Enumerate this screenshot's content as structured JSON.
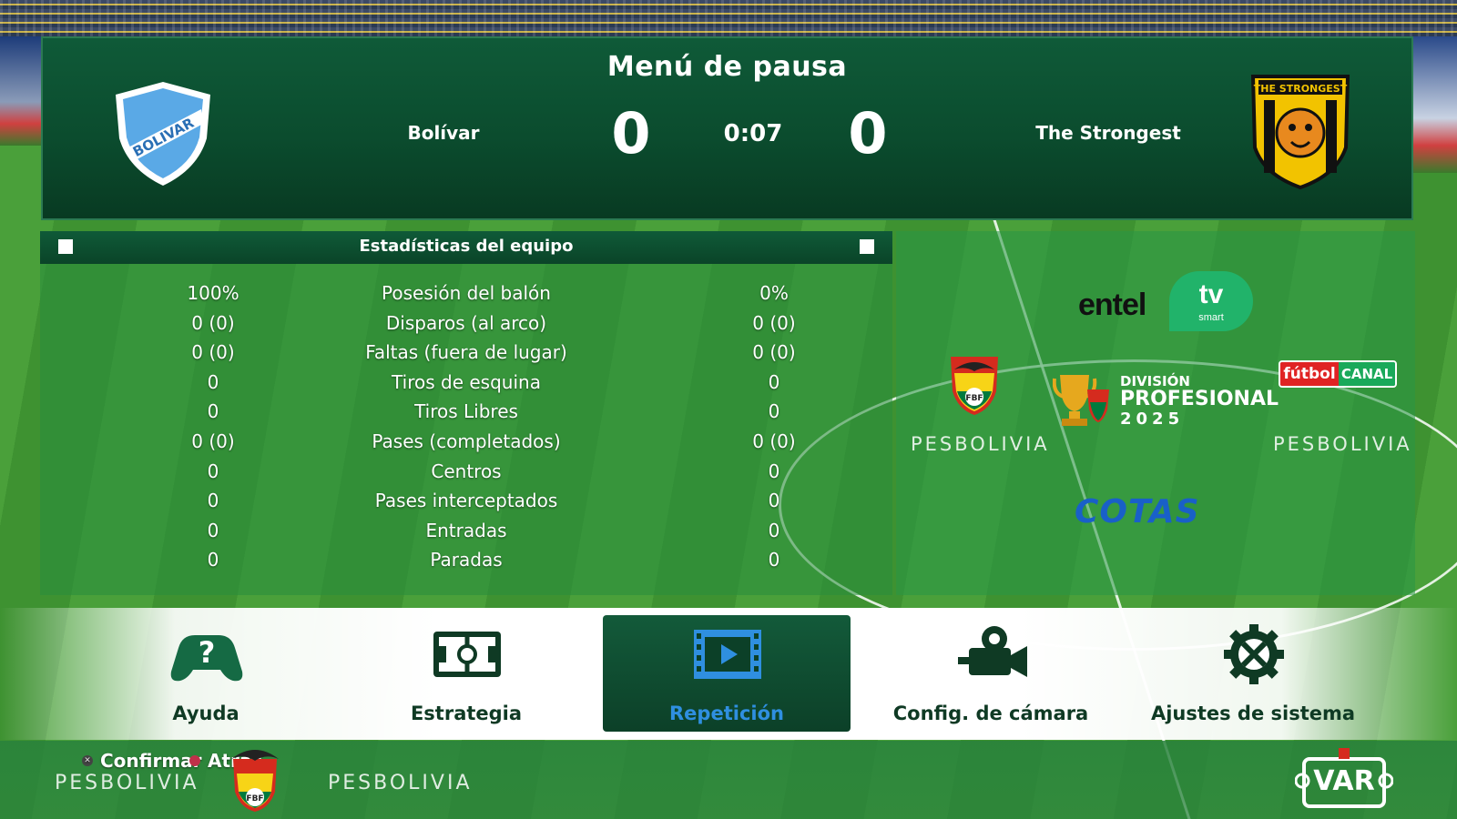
{
  "header": {
    "title": "Menú de pausa",
    "home_team": "Bolívar",
    "away_team": "The Strongest",
    "home_score": "0",
    "away_score": "0",
    "clock": "0:07",
    "home_crest_text": "BOLIVAR",
    "away_crest_text": "THE STRONGEST"
  },
  "stats": {
    "title": "Estadísticas del equipo",
    "rows": [
      {
        "home": "100%",
        "label": "Posesión del balón",
        "away": "0%"
      },
      {
        "home": "0 (0)",
        "label": "Disparos (al arco)",
        "away": "0 (0)"
      },
      {
        "home": "0 (0)",
        "label": "Faltas (fuera de lugar)",
        "away": "0 (0)"
      },
      {
        "home": "0",
        "label": "Tiros de esquina",
        "away": "0"
      },
      {
        "home": "0",
        "label": "Tiros Libres",
        "away": "0"
      },
      {
        "home": "0 (0)",
        "label": "Pases (completados)",
        "away": "0 (0)"
      },
      {
        "home": "0",
        "label": "Centros",
        "away": "0"
      },
      {
        "home": "0",
        "label": "Pases interceptados",
        "away": "0"
      },
      {
        "home": "0",
        "label": "Entradas",
        "away": "0"
      },
      {
        "home": "0",
        "label": "Paradas",
        "away": "0"
      }
    ]
  },
  "sponsors": {
    "entel": "entel",
    "entel_tv": "tv",
    "entel_smart": "smart",
    "pes": "PESBOLIVIA",
    "division_1": "DIVISIÓN",
    "division_2": "PROFESIONAL",
    "division_3": "2025",
    "futbol": "fútbol",
    "canal": "CANAL",
    "cotas": "COTAS",
    "fbf": "FBF"
  },
  "menu": {
    "items": [
      {
        "label": "Ayuda",
        "icon": "help-controller-icon"
      },
      {
        "label": "Estrategia",
        "icon": "strategy-field-icon"
      },
      {
        "label": "Repetición",
        "icon": "replay-film-icon"
      },
      {
        "label": "Config. de cámara",
        "icon": "camera-icon"
      },
      {
        "label": "Ajustes de sistema",
        "icon": "gear-icon"
      }
    ],
    "selected": "Repetición"
  },
  "footer": {
    "confirm": "Confirmar",
    "back": "Atrás",
    "confirm_button_glyph": "✕",
    "pes": "PESBOLIVIA",
    "var": "VAR"
  },
  "colors": {
    "panel_green": "#0b4c2e",
    "home_blue": "#5aa9e6",
    "away_yellow": "#f2c300",
    "selected_accent": "#2f8fe0"
  }
}
